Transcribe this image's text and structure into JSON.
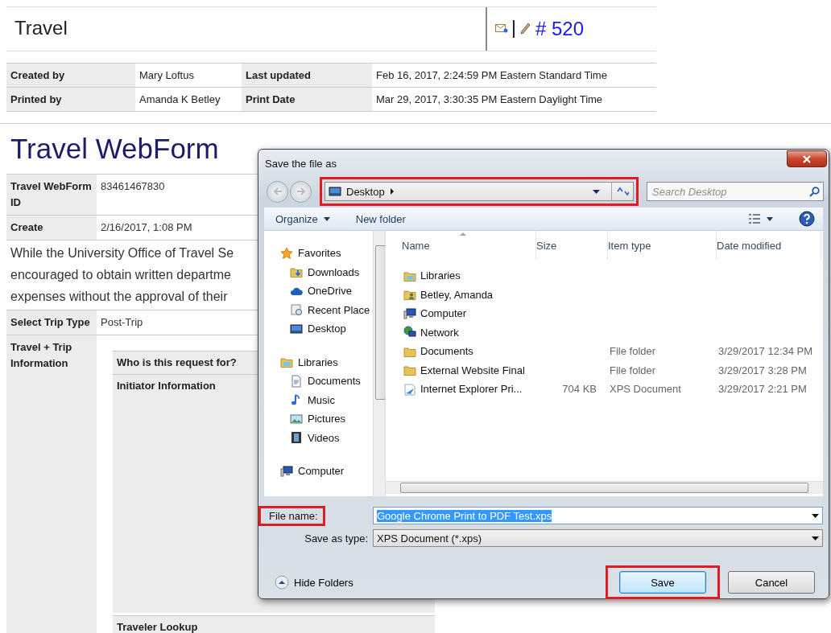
{
  "header": {
    "title": "Travel",
    "number": "# 520"
  },
  "meta": [
    {
      "label": "Created by",
      "value": "Mary Loftus"
    },
    {
      "label": "Last updated",
      "value": "Feb 16, 2017, 2:24:59 PM Eastern Standard Time"
    },
    {
      "label": "Printed by",
      "value": "Amanda K Betley"
    },
    {
      "label": "Print Date",
      "value": "Mar 29, 2017, 3:30:35 PM Eastern Daylight Time"
    }
  ],
  "form": {
    "title": "Travel WebForm",
    "fields": [
      {
        "label": "Travel WebForm ID",
        "value": "83461467830"
      },
      {
        "label": "Create",
        "value": "2/16/2017, 1:08 PM"
      }
    ],
    "notice_lines": [
      "While the University Office of Travel Se",
      "encouraged to obtain written departme",
      "expenses without the approval of their"
    ],
    "trip_type": {
      "label": "Select Trip Type",
      "value": "Post-Trip"
    },
    "section": {
      "label": "Travel + Trip Information",
      "rows": [
        "Who is this request for?",
        "Initiator Information",
        "Traveler Lookup"
      ]
    }
  },
  "dialog": {
    "title": "Save the file as",
    "location": {
      "label": "Desktop",
      "highlighted": true
    },
    "search_placeholder": "Search Desktop",
    "toolbar": [
      "Organize",
      "New folder"
    ],
    "nav": [
      {
        "label": "Favorites",
        "kind": "star",
        "children": [
          {
            "label": "Downloads",
            "kind": "downloads"
          },
          {
            "label": "OneDrive",
            "kind": "cloud"
          },
          {
            "label": "Recent Place",
            "kind": "recent"
          },
          {
            "label": "Desktop",
            "kind": "desktop"
          }
        ]
      },
      {
        "label": "Libraries",
        "kind": "library",
        "children": [
          {
            "label": "Documents",
            "kind": "document"
          },
          {
            "label": "Music",
            "kind": "music"
          },
          {
            "label": "Pictures",
            "kind": "pictures"
          },
          {
            "label": "Videos",
            "kind": "videos"
          }
        ]
      },
      {
        "label": "Computer",
        "kind": "computer"
      }
    ],
    "columns": [
      "Name",
      "Size",
      "Item type",
      "Date modified"
    ],
    "files": [
      {
        "name": "Libraries",
        "kind": "library"
      },
      {
        "name": "Betley, Amanda",
        "kind": "user"
      },
      {
        "name": "Computer",
        "kind": "computer"
      },
      {
        "name": "Network",
        "kind": "network"
      },
      {
        "name": "Documents",
        "kind": "folder",
        "type": "File folder",
        "date": "3/29/2017 12:34 PM"
      },
      {
        "name": "External Website Final",
        "kind": "folder",
        "type": "File folder",
        "date": "3/29/2017 3:28 PM"
      },
      {
        "name": "Internet Explorer Pri...",
        "kind": "xps",
        "size": "704 KB",
        "type": "XPS Document",
        "date": "3/29/2017 2:21 PM"
      }
    ],
    "file_name": {
      "label": "File name:",
      "value": "Google Chrome Print to PDF Test.xps",
      "text_selected": true,
      "highlighted": true
    },
    "save_type": {
      "label": "Save as type:",
      "value": "XPS Document (*.xps)"
    },
    "hide_folders": "Hide Folders",
    "buttons": [
      {
        "label": "Save",
        "default": true,
        "highlighted": true
      },
      {
        "label": "Cancel",
        "default": false,
        "highlighted": false
      }
    ]
  }
}
